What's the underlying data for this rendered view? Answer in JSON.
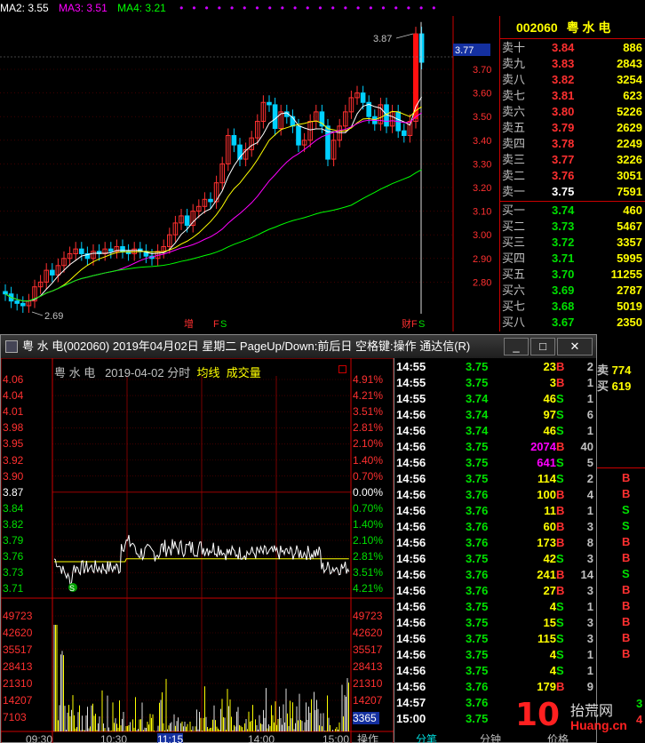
{
  "ma_legend": [
    {
      "label": "MA2: 3.55",
      "color": "#ffffff"
    },
    {
      "label": "MA3: 3.51",
      "color": "#ff00ff"
    },
    {
      "label": "MA4: 3.21",
      "color": "#00ff00"
    }
  ],
  "kline": {
    "y_ticks": [
      "3.70",
      "3.60",
      "3.50",
      "3.40",
      "3.30",
      "3.20",
      "3.10",
      "3.00",
      "2.90",
      "2.80"
    ],
    "current_price_tag": "3.77",
    "high_label": "3.87",
    "low_label": "2.69",
    "markers": [
      "增",
      "F",
      "S",
      "财",
      "F",
      "S"
    ]
  },
  "book": {
    "code": "002060",
    "name": "粤 水 电",
    "asks": [
      {
        "label": "卖十",
        "price": "3.84",
        "vol": "886",
        "color": "#ff3030"
      },
      {
        "label": "卖九",
        "price": "3.83",
        "vol": "2843",
        "color": "#ff3030"
      },
      {
        "label": "卖八",
        "price": "3.82",
        "vol": "3254",
        "color": "#ff3030"
      },
      {
        "label": "卖七",
        "price": "3.81",
        "vol": "623",
        "color": "#ff3030"
      },
      {
        "label": "卖六",
        "price": "3.80",
        "vol": "5226",
        "color": "#ff3030"
      },
      {
        "label": "卖五",
        "price": "3.79",
        "vol": "2629",
        "color": "#ff3030"
      },
      {
        "label": "卖四",
        "price": "3.78",
        "vol": "2249",
        "color": "#ff3030"
      },
      {
        "label": "卖三",
        "price": "3.77",
        "vol": "3226",
        "color": "#ff3030"
      },
      {
        "label": "卖二",
        "price": "3.76",
        "vol": "3051",
        "color": "#ff3030"
      },
      {
        "label": "卖一",
        "price": "3.75",
        "vol": "7591",
        "color": "#ffffff"
      }
    ],
    "bids": [
      {
        "label": "买一",
        "price": "3.74",
        "vol": "460",
        "color": "#00e000"
      },
      {
        "label": "买二",
        "price": "3.73",
        "vol": "5467",
        "color": "#00e000"
      },
      {
        "label": "买三",
        "price": "3.72",
        "vol": "3357",
        "color": "#00e000"
      },
      {
        "label": "买四",
        "price": "3.71",
        "vol": "5995",
        "color": "#00e000"
      },
      {
        "label": "买五",
        "price": "3.70",
        "vol": "11255",
        "color": "#00e000"
      },
      {
        "label": "买六",
        "price": "3.69",
        "vol": "2787",
        "color": "#00e000"
      },
      {
        "label": "买七",
        "price": "3.68",
        "vol": "5019",
        "color": "#00e000"
      },
      {
        "label": "买八",
        "price": "3.67",
        "vol": "2350",
        "color": "#00e000"
      },
      {
        "label": "买九",
        "price": "3.66",
        "vol": "2712",
        "color": "#00e000"
      },
      {
        "label": "买十",
        "price": "3.65",
        "vol": "4088",
        "color": "#00e000"
      }
    ]
  },
  "window": {
    "title": "粤 水 电(002060) 2019年04月02日 星期二 PageUp/Down:前后日 空格键:操作 通达信(R)",
    "min_label": "_",
    "max_label": "□",
    "close_label": "✕",
    "stock": "粤 水 电",
    "date_label": "2019-04-02 分时",
    "avg_label": "均线",
    "vol_label": "成交量"
  },
  "intraday": {
    "price_ticks": [
      {
        "l": "4.06",
        "r": "4.91%",
        "c": "#ff3030"
      },
      {
        "l": "4.04",
        "r": "4.21%",
        "c": "#ff3030"
      },
      {
        "l": "4.01",
        "r": "3.51%",
        "c": "#ff3030"
      },
      {
        "l": "3.98",
        "r": "2.81%",
        "c": "#ff3030"
      },
      {
        "l": "3.95",
        "r": "2.10%",
        "c": "#ff3030"
      },
      {
        "l": "3.92",
        "r": "1.40%",
        "c": "#ff3030"
      },
      {
        "l": "3.90",
        "r": "0.70%",
        "c": "#ff3030"
      },
      {
        "l": "3.87",
        "r": "0.00%",
        "c": "#ffffff"
      },
      {
        "l": "3.84",
        "r": "0.70%",
        "c": "#00e000"
      },
      {
        "l": "3.82",
        "r": "1.40%",
        "c": "#00e000"
      },
      {
        "l": "3.79",
        "r": "2.10%",
        "c": "#00e000"
      },
      {
        "l": "3.76",
        "r": "2.81%",
        "c": "#00e000"
      },
      {
        "l": "3.73",
        "r": "3.51%",
        "c": "#00e000"
      },
      {
        "l": "3.71",
        "r": "4.21%",
        "c": "#00e000"
      }
    ],
    "vol_ticks": [
      "49723",
      "42620",
      "35517",
      "28413",
      "21310",
      "14207",
      "7103"
    ],
    "vol_current": "3365",
    "time_ticks": [
      "09:30",
      "10:30",
      "11:15",
      "14:00",
      "15:00"
    ],
    "s_marker": "S"
  },
  "ticks": [
    {
      "t": "14:55",
      "p": "3.75",
      "v": "23",
      "d": "B",
      "n": "2",
      "vc": "#ffff00"
    },
    {
      "t": "14:55",
      "p": "3.75",
      "v": "3",
      "d": "B",
      "n": "1",
      "vc": "#ffff00"
    },
    {
      "t": "14:55",
      "p": "3.74",
      "v": "46",
      "d": "S",
      "n": "1",
      "vc": "#ffff00"
    },
    {
      "t": "14:56",
      "p": "3.74",
      "v": "97",
      "d": "S",
      "n": "6",
      "vc": "#ffff00"
    },
    {
      "t": "14:56",
      "p": "3.74",
      "v": "46",
      "d": "S",
      "n": "1",
      "vc": "#ffff00"
    },
    {
      "t": "14:56",
      "p": "3.75",
      "v": "2074",
      "d": "B",
      "n": "40",
      "vc": "#ff00ff"
    },
    {
      "t": "14:56",
      "p": "3.75",
      "v": "641",
      "d": "S",
      "n": "5",
      "vc": "#ff00ff"
    },
    {
      "t": "14:56",
      "p": "3.75",
      "v": "114",
      "d": "S",
      "n": "2",
      "vc": "#ffff00"
    },
    {
      "t": "14:56",
      "p": "3.76",
      "v": "100",
      "d": "B",
      "n": "4",
      "vc": "#ffff00"
    },
    {
      "t": "14:56",
      "p": "3.76",
      "v": "11",
      "d": "B",
      "n": "1",
      "vc": "#ffff00"
    },
    {
      "t": "14:56",
      "p": "3.76",
      "v": "60",
      "d": "B",
      "n": "3",
      "vc": "#ffff00"
    },
    {
      "t": "14:56",
      "p": "3.76",
      "v": "173",
      "d": "B",
      "n": "8",
      "vc": "#ffff00"
    },
    {
      "t": "14:56",
      "p": "3.75",
      "v": "42",
      "d": "S",
      "n": "3",
      "vc": "#ffff00"
    },
    {
      "t": "14:56",
      "p": "3.76",
      "v": "241",
      "d": "B",
      "n": "14",
      "vc": "#ffff00"
    },
    {
      "t": "14:56",
      "p": "3.76",
      "v": "27",
      "d": "B",
      "n": "3",
      "vc": "#ffff00"
    },
    {
      "t": "14:56",
      "p": "3.75",
      "v": "4",
      "d": "S",
      "n": "1",
      "vc": "#ffff00"
    },
    {
      "t": "14:56",
      "p": "3.75",
      "v": "15",
      "d": "S",
      "n": "3",
      "vc": "#ffff00"
    },
    {
      "t": "14:56",
      "p": "3.75",
      "v": "115",
      "d": "S",
      "n": "3",
      "vc": "#ffff00"
    },
    {
      "t": "14:56",
      "p": "3.75",
      "v": "4",
      "d": "S",
      "n": "1",
      "vc": "#ffff00"
    },
    {
      "t": "14:56",
      "p": "3.75",
      "v": "4",
      "d": "S",
      "n": "1",
      "vc": "#ffff00"
    },
    {
      "t": "14:56",
      "p": "3.76",
      "v": "179",
      "d": "B",
      "n": "9",
      "vc": "#ffff00"
    },
    {
      "t": "14:57",
      "p": "3.76",
      "v": "",
      "d": "",
      "n": "",
      "vc": "#ffff00"
    },
    {
      "t": "15:00",
      "p": "3.75",
      "v": "",
      "d": "",
      "n": "",
      "vc": "#ffff00"
    }
  ],
  "tabs": [
    "操作",
    "分笔",
    "分钟",
    "价格"
  ],
  "right_strip": {
    "sell_label": "卖",
    "sell_vol": "774",
    "buy_label": "买",
    "buy_vol": "619",
    "marks": [
      "B",
      "B",
      "S",
      "S",
      "B",
      "B",
      "S",
      "B",
      "B",
      "B",
      "B",
      "B"
    ],
    "bottom_a": "3",
    "bottom_b": "4"
  },
  "watermark": {
    "num": "10",
    "cn": "抬荒网",
    "url": "Huang.cn"
  }
}
